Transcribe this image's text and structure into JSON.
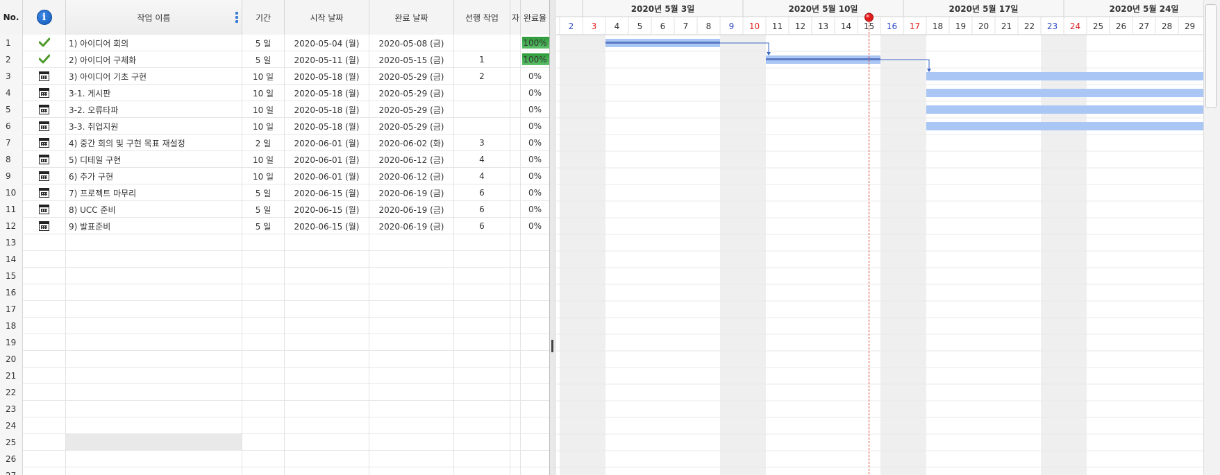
{
  "columns": {
    "no": "No.",
    "name": "작업 이름",
    "duration": "기간",
    "start": "시작 날짜",
    "end": "완료 날짜",
    "predecessor": "선행 작업",
    "resource": "자",
    "progress": "완료율"
  },
  "tasks": [
    {
      "no": "1",
      "icon": "check-icon",
      "name": "1) 아이디어 회의",
      "duration": "5 일",
      "start": "2020-05-04 (월)",
      "end": "2020-05-08 (금)",
      "pred": "",
      "progress": "100%",
      "progress_value": 100
    },
    {
      "no": "2",
      "icon": "check-icon",
      "name": "2) 아이디어 구체화",
      "duration": "5 일",
      "start": "2020-05-11 (월)",
      "end": "2020-05-15 (금)",
      "pred": "1",
      "progress": "100%",
      "progress_value": 100
    },
    {
      "no": "3",
      "icon": "calendar-icon",
      "name": "3) 아이디어 기초 구현",
      "duration": "10 일",
      "start": "2020-05-18 (월)",
      "end": "2020-05-29 (금)",
      "pred": "2",
      "progress": "0%",
      "progress_value": 0
    },
    {
      "no": "4",
      "icon": "calendar-icon",
      "name": "3-1. 게시판",
      "duration": "10 일",
      "start": "2020-05-18 (월)",
      "end": "2020-05-29 (금)",
      "pred": "",
      "progress": "0%",
      "progress_value": 0
    },
    {
      "no": "5",
      "icon": "calendar-icon",
      "name": "3-2. 오류타파",
      "duration": "10 일",
      "start": "2020-05-18 (월)",
      "end": "2020-05-29 (금)",
      "pred": "",
      "progress": "0%",
      "progress_value": 0
    },
    {
      "no": "6",
      "icon": "calendar-icon",
      "name": "3-3. 취업지원",
      "duration": "10 일",
      "start": "2020-05-18 (월)",
      "end": "2020-05-29 (금)",
      "pred": "",
      "progress": "0%",
      "progress_value": 0
    },
    {
      "no": "7",
      "icon": "calendar-icon",
      "name": "4) 중간 회의 및 구현 목표 재설정",
      "duration": "2 일",
      "start": "2020-06-01 (월)",
      "end": "2020-06-02 (화)",
      "pred": "3",
      "progress": "0%",
      "progress_value": 0
    },
    {
      "no": "8",
      "icon": "calendar-icon",
      "name": "5) 디테일 구현",
      "duration": "10 일",
      "start": "2020-06-01 (월)",
      "end": "2020-06-12 (금)",
      "pred": "4",
      "progress": "0%",
      "progress_value": 0
    },
    {
      "no": "9",
      "icon": "calendar-icon",
      "name": "6) 추가 구현",
      "duration": "10 일",
      "start": "2020-06-01 (월)",
      "end": "2020-06-12 (금)",
      "pred": "4",
      "progress": "0%",
      "progress_value": 0
    },
    {
      "no": "10",
      "icon": "calendar-icon",
      "name": "7) 프로젝트 마무리",
      "duration": "5 일",
      "start": "2020-06-15 (월)",
      "end": "2020-06-19 (금)",
      "pred": "6",
      "progress": "0%",
      "progress_value": 0
    },
    {
      "no": "11",
      "icon": "calendar-icon",
      "name": "8) UCC 준비",
      "duration": "5 일",
      "start": "2020-06-15 (월)",
      "end": "2020-06-19 (금)",
      "pred": "6",
      "progress": "0%",
      "progress_value": 0
    },
    {
      "no": "12",
      "icon": "calendar-icon",
      "name": "9) 발표준비",
      "duration": "5 일",
      "start": "2020-06-15 (월)",
      "end": "2020-06-19 (금)",
      "pred": "6",
      "progress": "0%",
      "progress_value": 0
    }
  ],
  "empty_rows": [
    "13",
    "14",
    "15",
    "16",
    "17",
    "18",
    "19",
    "20",
    "21",
    "22",
    "23",
    "24",
    "25",
    "26",
    "27"
  ],
  "timeline": {
    "weeks": [
      "2020년 5월 3일",
      "2020년 5월 10일",
      "2020년 5월 17일",
      "2020년 5월 24일"
    ],
    "days": [
      "2",
      "3",
      "4",
      "5",
      "6",
      "7",
      "8",
      "9",
      "10",
      "11",
      "12",
      "13",
      "14",
      "15",
      "16",
      "17",
      "18",
      "19",
      "20",
      "21",
      "22",
      "23",
      "24",
      "25",
      "26",
      "27",
      "28",
      "29"
    ],
    "saturday_color": "#2b48c6",
    "sunday_color": "#e02020",
    "today_index": 13,
    "bars": [
      {
        "row": 0,
        "start_index": 2,
        "end_index": 6,
        "done": true
      },
      {
        "row": 1,
        "start_index": 9,
        "end_index": 13,
        "done": true
      },
      {
        "row": 2,
        "start_index": 16,
        "end_index": 30,
        "done": false
      },
      {
        "row": 3,
        "start_index": 16,
        "end_index": 30,
        "done": false
      },
      {
        "row": 4,
        "start_index": 16,
        "end_index": 30,
        "done": false
      },
      {
        "row": 5,
        "start_index": 16,
        "end_index": 30,
        "done": false
      }
    ],
    "links": [
      {
        "from_row": 0,
        "to_row": 1
      },
      {
        "from_row": 1,
        "to_row": 2
      }
    ],
    "bar_color": "#a9c6f5",
    "done_line_color": "#5b7ac4",
    "today_color": "#e03a2a"
  }
}
